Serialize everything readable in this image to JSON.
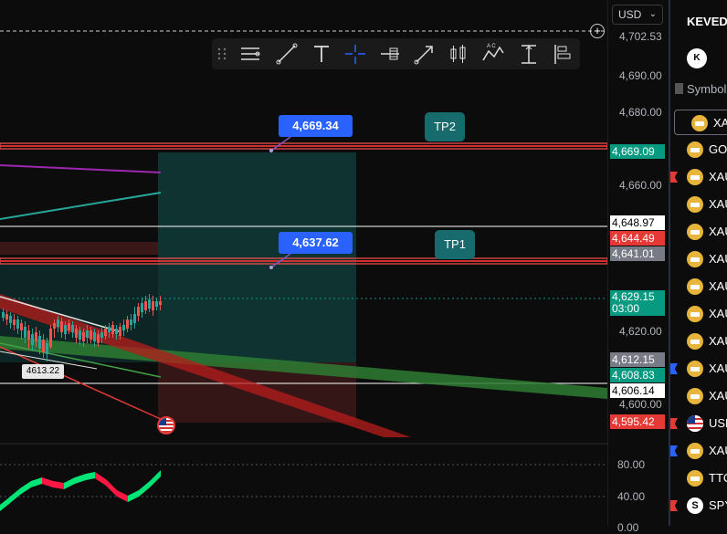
{
  "currency": {
    "value": "USD"
  },
  "price_axis": {
    "ticks": [
      "4,702.53",
      "4,690.00",
      "4,680.00",
      "4,660.00",
      "4,620.00",
      "4,600.00"
    ],
    "labels": [
      {
        "text": "4,669.09",
        "bg": "#089981",
        "fg": "#ffffff"
      },
      {
        "text": "4,648.97",
        "bg": "#ffffff",
        "fg": "#000000"
      },
      {
        "text": "4,644.49",
        "bg": "#e53935",
        "fg": "#ffffff"
      },
      {
        "text": "4,641.01",
        "bg": "#787b86",
        "fg": "#ffffff"
      },
      {
        "text": "4,629.15",
        "sub": "03:00",
        "bg": "#089981",
        "fg": "#ffffff"
      },
      {
        "text": "4,612.15",
        "bg": "#787b86",
        "fg": "#ffffff"
      },
      {
        "text": "4,608.83",
        "bg": "#089981",
        "fg": "#ffffff"
      },
      {
        "text": "4,606.14",
        "bg": "#ffffff",
        "fg": "#000000"
      },
      {
        "text": "4,595.42",
        "bg": "#e53935",
        "fg": "#ffffff"
      }
    ]
  },
  "oscillator": {
    "ticks": [
      "80.00",
      "40.00",
      "0.00"
    ]
  },
  "callouts": {
    "upper": "4,669.34",
    "lower": "4,637.62",
    "color": "#2962ff"
  },
  "targets": {
    "tp2": "TP2",
    "tp1": "TP1"
  },
  "low_marker": "4613.22",
  "toolbar": {
    "tools": [
      "horizontal-lines-icon",
      "trend-line-icon",
      "text-icon",
      "crosshair-icon",
      "long-position-icon",
      "arrow-icon",
      "candles-icon",
      "abcd-pattern-icon",
      "anchored-text-icon",
      "bars-pattern-icon"
    ]
  },
  "watchlist": {
    "title": "KEVEDO",
    "avatar": "K",
    "symbol_header": "Symbol",
    "rows": [
      {
        "label": "XAU",
        "flag": "",
        "coin": "gold",
        "selected": true
      },
      {
        "label": "GOL",
        "flag": "",
        "coin": "gold"
      },
      {
        "label": "XAU",
        "flag": "#e53935",
        "coin": "gold"
      },
      {
        "label": "XAU",
        "flag": "",
        "coin": "gold"
      },
      {
        "label": "XAU",
        "flag": "",
        "coin": "gold"
      },
      {
        "label": "XAU",
        "flag": "",
        "coin": "gold"
      },
      {
        "label": "XAU",
        "flag": "",
        "coin": "gold"
      },
      {
        "label": "XAU",
        "flag": "",
        "coin": "gold"
      },
      {
        "label": "XAU",
        "flag": "",
        "coin": "gold"
      },
      {
        "label": "XAU",
        "flag": "#2962ff",
        "coin": "gold"
      },
      {
        "label": "XAU",
        "flag": "",
        "coin": "gold"
      },
      {
        "label": "USD",
        "flag": "#e53935",
        "coin": "usflag"
      },
      {
        "label": "XAU",
        "flag": "#2962ff",
        "coin": "gold"
      },
      {
        "label": "TTC",
        "flag": "",
        "coin": "gold"
      },
      {
        "label": "SPY",
        "flag": "#e53935",
        "coin": "spy",
        "glyph": "S"
      }
    ]
  },
  "colors": {
    "bull": "#089981",
    "bear": "#e53935",
    "resistance": "#ff5252"
  }
}
